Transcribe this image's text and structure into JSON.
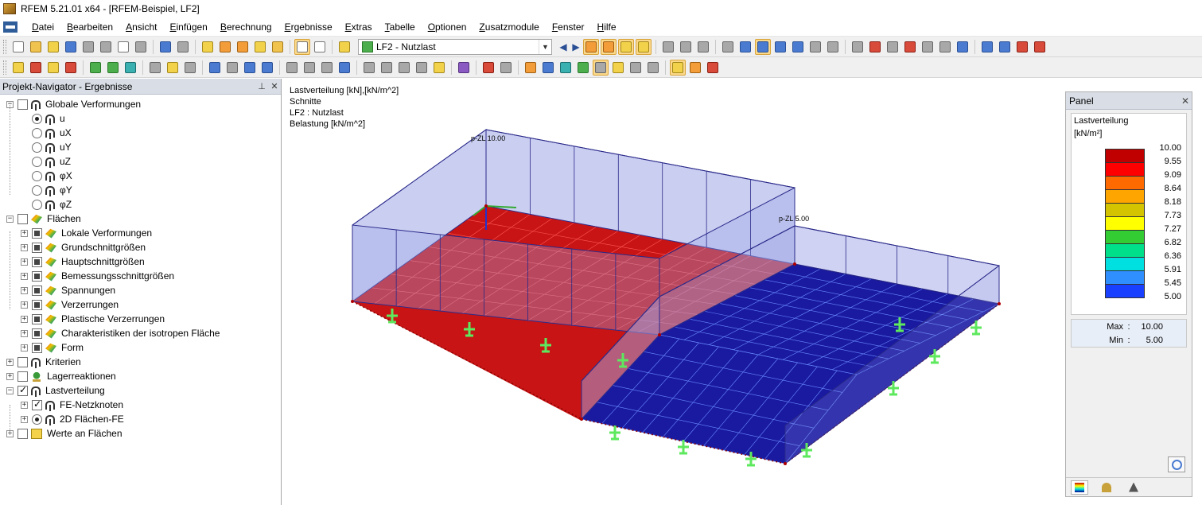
{
  "titlebar": {
    "title": "RFEM 5.21.01 x64 - [RFEM-Beispiel, LF2]"
  },
  "menu": [
    {
      "label": "Datei",
      "acc": "D",
      "rest": "atei"
    },
    {
      "label": "Bearbeiten",
      "acc": "B",
      "rest": "earbeiten"
    },
    {
      "label": "Ansicht",
      "acc": "A",
      "rest": "nsicht"
    },
    {
      "label": "Einfügen",
      "acc": "E",
      "rest": "infügen"
    },
    {
      "label": "Berechnung",
      "acc": "B",
      "rest": "erechnung"
    },
    {
      "label": "Ergebnisse",
      "acc": "E",
      "rest": "rgebnisse"
    },
    {
      "label": "Extras",
      "acc": "E",
      "rest": "xtras"
    },
    {
      "label": "Tabelle",
      "acc": "T",
      "rest": "abelle"
    },
    {
      "label": "Optionen",
      "acc": "O",
      "rest": "ptionen"
    },
    {
      "label": "Zusatzmodule",
      "acc": "Z",
      "rest": "usatzmodule"
    },
    {
      "label": "Fenster",
      "acc": "F",
      "rest": "enster"
    },
    {
      "label": "Hilfe",
      "acc": "H",
      "rest": "ilfe"
    }
  ],
  "toolbar": {
    "loadcase": "LF2 - Nutzlast"
  },
  "navigator": {
    "title": "Projekt-Navigator - Ergebnisse",
    "items": [
      {
        "label": "Globale Verformungen",
        "level": 0,
        "exp": "-",
        "ctl": "chk",
        "state": "",
        "icon": "frame"
      },
      {
        "label": "u",
        "level": 1,
        "exp": "",
        "ctl": "rad",
        "state": "checked",
        "icon": "frame"
      },
      {
        "label": "uX",
        "level": 1,
        "exp": "",
        "ctl": "rad",
        "state": "",
        "icon": "frame"
      },
      {
        "label": "uY",
        "level": 1,
        "exp": "",
        "ctl": "rad",
        "state": "",
        "icon": "frame"
      },
      {
        "label": "uZ",
        "level": 1,
        "exp": "",
        "ctl": "rad",
        "state": "",
        "icon": "frame"
      },
      {
        "label": "φX",
        "level": 1,
        "exp": "",
        "ctl": "rad",
        "state": "",
        "icon": "frame"
      },
      {
        "label": "φY",
        "level": 1,
        "exp": "",
        "ctl": "rad",
        "state": "",
        "icon": "frame"
      },
      {
        "label": "φZ",
        "level": 1,
        "exp": "",
        "ctl": "rad",
        "state": "",
        "icon": "frame"
      },
      {
        "label": "Flächen",
        "level": 0,
        "exp": "-",
        "ctl": "chk",
        "state": "",
        "icon": "surf"
      },
      {
        "label": "Lokale Verformungen",
        "level": 1,
        "exp": "+",
        "ctl": "chk",
        "state": "partial",
        "icon": "surf"
      },
      {
        "label": "Grundschnittgrößen",
        "level": 1,
        "exp": "+",
        "ctl": "chk",
        "state": "partial",
        "icon": "surf"
      },
      {
        "label": "Hauptschnittgrößen",
        "level": 1,
        "exp": "+",
        "ctl": "chk",
        "state": "partial",
        "icon": "surf"
      },
      {
        "label": "Bemessungsschnittgrößen",
        "level": 1,
        "exp": "+",
        "ctl": "chk",
        "state": "partial",
        "icon": "surf"
      },
      {
        "label": "Spannungen",
        "level": 1,
        "exp": "+",
        "ctl": "chk",
        "state": "partial",
        "icon": "surf"
      },
      {
        "label": "Verzerrungen",
        "level": 1,
        "exp": "+",
        "ctl": "chk",
        "state": "partial",
        "icon": "surf"
      },
      {
        "label": "Plastische Verzerrungen",
        "level": 1,
        "exp": "+",
        "ctl": "chk",
        "state": "partial",
        "icon": "surf"
      },
      {
        "label": "Charakteristiken der isotropen Fläche",
        "level": 1,
        "exp": "+",
        "ctl": "chk",
        "state": "partial",
        "icon": "surf"
      },
      {
        "label": "Form",
        "level": 1,
        "exp": "+",
        "ctl": "chk",
        "state": "partial",
        "icon": "surf"
      },
      {
        "label": "Kriterien",
        "level": 0,
        "exp": "+",
        "ctl": "chk",
        "state": "",
        "icon": "frame"
      },
      {
        "label": "Lagerreaktionen",
        "level": 0,
        "exp": "+",
        "ctl": "chk",
        "state": "",
        "icon": "support"
      },
      {
        "label": "Lastverteilung",
        "level": 0,
        "exp": "-",
        "ctl": "chk",
        "state": "checked",
        "icon": "frame"
      },
      {
        "label": "FE-Netzknoten",
        "level": 1,
        "exp": "+",
        "ctl": "chk",
        "state": "checked",
        "icon": "frame"
      },
      {
        "label": "2D Flächen-FE",
        "level": 1,
        "exp": "+",
        "ctl": "rad",
        "state": "checked",
        "icon": "frame"
      },
      {
        "label": "Werte an Flächen",
        "level": 0,
        "exp": "+",
        "ctl": "chk",
        "state": "",
        "icon": "values"
      }
    ]
  },
  "viewport": {
    "info": [
      "Lastverteilung [kN],[kN/m^2]",
      "Schnitte",
      "LF2 : Nutzlast",
      "Belastung [kN/m^2]"
    ],
    "labels": {
      "load1": "p-ZL 10.00",
      "load2": "p-ZL 5.00"
    },
    "colors": {
      "red": "#c81414",
      "blue": "#1a1aa0",
      "mesh": "#6a8cff",
      "support": "#5ee85e"
    }
  },
  "panel": {
    "title": "Panel",
    "legend_title": "Lastverteilung",
    "unit": "[kN/m²]",
    "legend": [
      {
        "value": "10.00",
        "color": "#c00000"
      },
      {
        "value": "9.55",
        "color": "#ff0000"
      },
      {
        "value": "9.09",
        "color": "#ff6a00"
      },
      {
        "value": "8.64",
        "color": "#ffa500"
      },
      {
        "value": "8.18",
        "color": "#d4c400"
      },
      {
        "value": "7.73",
        "color": "#ffff00"
      },
      {
        "value": "7.27",
        "color": "#33cc33"
      },
      {
        "value": "6.82",
        "color": "#00e08a"
      },
      {
        "value": "6.36",
        "color": "#00e0e0"
      },
      {
        "value": "5.91",
        "color": "#2f8fff"
      },
      {
        "value": "5.45",
        "color": "#1a40ff"
      },
      {
        "value": "5.00",
        "color": "#000090"
      }
    ],
    "max_label": "Max",
    "max_value": "10.00",
    "min_label": "Min",
    "min_value": "5.00",
    "colon": ":"
  }
}
